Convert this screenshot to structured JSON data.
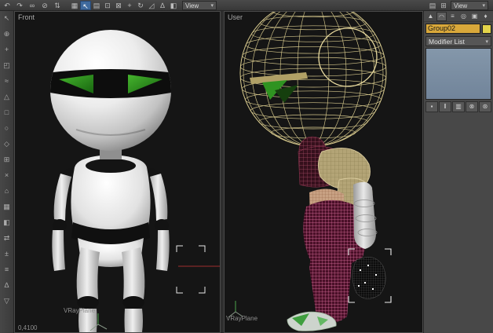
{
  "top_toolbar": {
    "icons_left": [
      {
        "name": "undo",
        "glyph": "↶"
      },
      {
        "name": "redo",
        "glyph": "↷"
      },
      {
        "name": "select-link",
        "glyph": "∞"
      },
      {
        "name": "unlink-selection",
        "glyph": "⊘"
      },
      {
        "name": "bind-to-space-warp",
        "glyph": "⇅"
      }
    ],
    "icons_main": [
      {
        "name": "selection-filter",
        "glyph": "▦"
      },
      {
        "name": "select-object",
        "glyph": "↖"
      },
      {
        "name": "select-by-name",
        "glyph": "▤"
      },
      {
        "name": "rectangular-selection-region",
        "glyph": "⊡"
      },
      {
        "name": "window-crossing",
        "glyph": "⊠"
      },
      {
        "name": "select-and-move",
        "glyph": "+"
      },
      {
        "name": "select-and-rotate",
        "glyph": "↻"
      },
      {
        "name": "select-and-scale",
        "glyph": "◿"
      },
      {
        "name": "snap-toggle",
        "glyph": "∆"
      },
      {
        "name": "mirror",
        "glyph": "◧"
      }
    ],
    "coord_system_value": "View",
    "icons_right": [
      {
        "name": "manage-layers",
        "glyph": "▤"
      },
      {
        "name": "curve-editor",
        "glyph": "⊞"
      }
    ],
    "view_dropdown_value": "View",
    "dropdown_caret": "▾"
  },
  "left_toolbar": {
    "icons": [
      {
        "name": "arrow-icon",
        "glyph": "↖"
      },
      {
        "name": "plus-circle-icon",
        "glyph": "⊕"
      },
      {
        "name": "plus-icon",
        "glyph": "+"
      },
      {
        "name": "corner-box-icon",
        "glyph": "◰"
      },
      {
        "name": "waves-icon",
        "glyph": "≈"
      },
      {
        "name": "triangle-icon",
        "glyph": "△"
      },
      {
        "name": "square-icon",
        "glyph": "□"
      },
      {
        "name": "circle-icon",
        "glyph": "○"
      },
      {
        "name": "diamond-icon",
        "glyph": "◇"
      },
      {
        "name": "grid-icon",
        "glyph": "⊞"
      },
      {
        "name": "cross-icon",
        "glyph": "×"
      },
      {
        "name": "house-icon",
        "glyph": "⌂"
      },
      {
        "name": "mesh-icon",
        "glyph": "▦"
      },
      {
        "name": "half-square-icon",
        "glyph": "◧"
      },
      {
        "name": "swap-arrows-icon",
        "glyph": "⇄"
      },
      {
        "name": "plus-minus-icon",
        "glyph": "±"
      },
      {
        "name": "lines-icon",
        "glyph": "≡"
      },
      {
        "name": "delta-icon",
        "glyph": "∆"
      },
      {
        "name": "down-triangle-icon",
        "glyph": "▽"
      }
    ]
  },
  "viewport_front": {
    "label": "Front",
    "plane_label": "VRayPlane",
    "status_coordinates": "0,4100"
  },
  "viewport_user": {
    "label": "User",
    "plane_label": "VRayPlane"
  },
  "command_panel": {
    "tabs": [
      {
        "name": "create",
        "glyph": "▲"
      },
      {
        "name": "modify",
        "glyph": "◠"
      },
      {
        "name": "hierarchy",
        "glyph": "≡"
      },
      {
        "name": "motion",
        "glyph": "◎"
      },
      {
        "name": "display",
        "glyph": "▣"
      },
      {
        "name": "utilities",
        "glyph": "♦"
      }
    ],
    "object_name": "Group02",
    "modifier_list_label": "Modifier List",
    "dropdown_caret": "▾",
    "stack_buttons": [
      {
        "name": "pin-stack",
        "glyph": "▪"
      },
      {
        "name": "show-end-result",
        "glyph": "‖"
      },
      {
        "name": "make-unique",
        "glyph": "▥"
      },
      {
        "name": "remove-modifier",
        "glyph": "⊗"
      },
      {
        "name": "configure-modifier-sets",
        "glyph": "⊛"
      }
    ]
  },
  "colors": {
    "name_field_bg": "#d9a83a",
    "object_color_swatch": "#e3d44a",
    "stack_box_bg": "#7b8da0",
    "active_tool_bg": "#3f6a9e",
    "wireframe_yellow": "#d6c88c",
    "mesh_pink": "#e0719f",
    "eye_green": "#2f9321"
  }
}
